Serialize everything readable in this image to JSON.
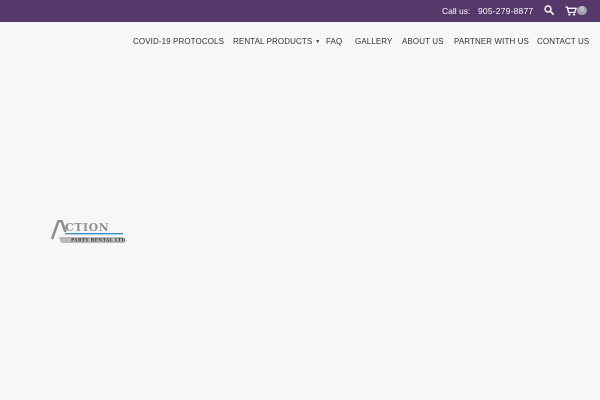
{
  "topbar": {
    "call_label": "Call us:",
    "phone": "905-279-8877",
    "search_icon": "search-icon",
    "cart_icon": "shopping-cart-icon",
    "cart_count": "0",
    "background_color": "#553869"
  },
  "nav": {
    "items": [
      {
        "label": "COVID-19 PROTOCOLS"
      },
      {
        "label": "RENTAL PRODUCTS",
        "has_dropdown": true
      },
      {
        "label": "FAQ"
      },
      {
        "label": "GALLERY"
      },
      {
        "label": "ABOUT US"
      },
      {
        "label": "PARTNER WITH US"
      },
      {
        "label": "CONTACT US"
      }
    ]
  },
  "logo": {
    "brand_text": "ACTION",
    "sub_text": "PARTY RENTAL LTD."
  },
  "colors": {
    "page_background": "#f7f7f7",
    "nav_text": "#333333"
  }
}
